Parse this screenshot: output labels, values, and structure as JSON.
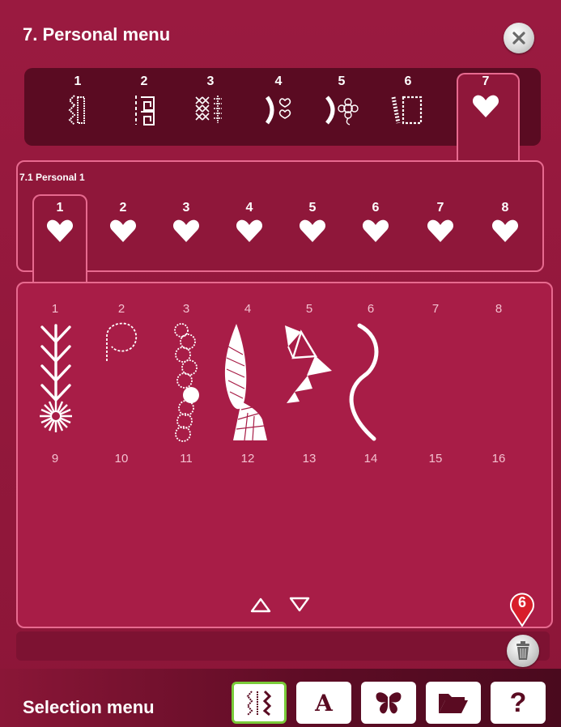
{
  "window": {
    "title": "7. Personal menu"
  },
  "categories": [
    {
      "num": "1",
      "icon": "zigzag-stitch-icon"
    },
    {
      "num": "2",
      "icon": "greek-key-stitch-icon"
    },
    {
      "num": "3",
      "icon": "cross-stitch-icon"
    },
    {
      "num": "4",
      "icon": "heart-scallop-stitch-icon"
    },
    {
      "num": "5",
      "icon": "floral-stitch-icon"
    },
    {
      "num": "6",
      "icon": "rectangle-outline-stitch-icon"
    },
    {
      "num": "7",
      "icon": "heart-icon"
    }
  ],
  "subtabs": {
    "title": "7.1 Personal 1",
    "items": [
      {
        "num": "1"
      },
      {
        "num": "2"
      },
      {
        "num": "3"
      },
      {
        "num": "4"
      },
      {
        "num": "5"
      },
      {
        "num": "6"
      },
      {
        "num": "7"
      },
      {
        "num": "8"
      }
    ]
  },
  "slots": {
    "row1": [
      "1",
      "2",
      "3",
      "4",
      "5",
      "6",
      "7",
      "8"
    ],
    "row2": [
      "9",
      "10",
      "11",
      "12",
      "13",
      "14",
      "15",
      "16"
    ]
  },
  "colors": {
    "background": "#9a1a40",
    "panel": "#a81d47",
    "border": "#e76a8f",
    "active_button_border": "#7acb3a"
  },
  "callout": {
    "number": "6"
  },
  "bottom": {
    "label": "Selection menu",
    "buttons": [
      {
        "name": "stitches",
        "icon": "stitch-icon"
      },
      {
        "name": "font",
        "glyph": "A"
      },
      {
        "name": "embroidery",
        "icon": "butterfly-icon"
      },
      {
        "name": "file-manager",
        "icon": "folder-icon"
      },
      {
        "name": "help",
        "glyph": "?"
      }
    ]
  }
}
